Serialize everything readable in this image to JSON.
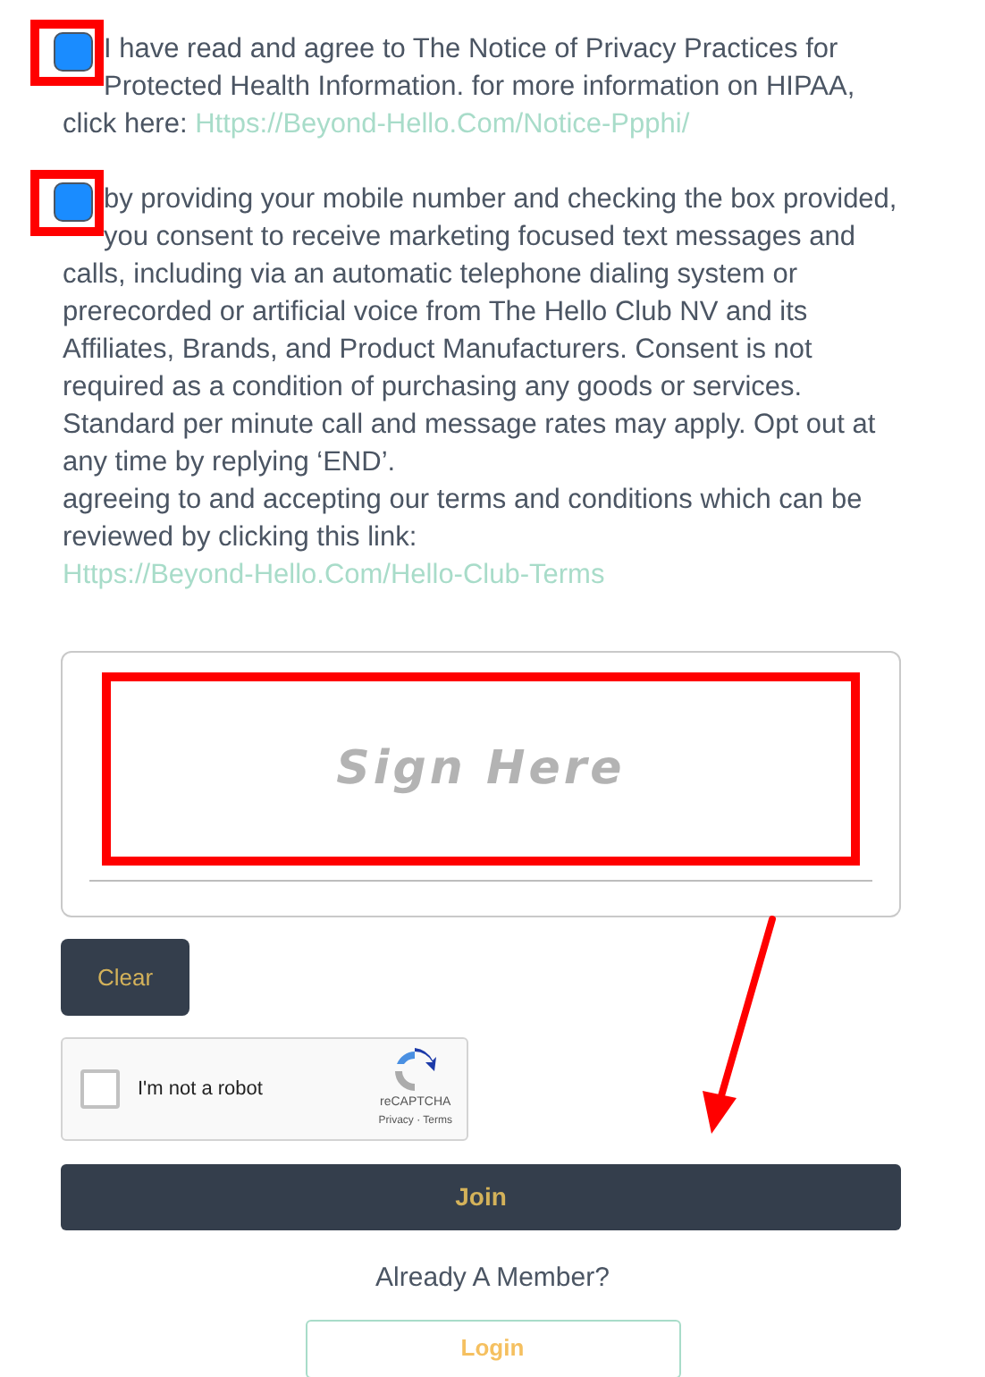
{
  "consents": [
    {
      "checked": true,
      "text": "I have read and agree to The Notice of Privacy Practices for Protected Health Information. for more information on HIPAA, click here:",
      "link": "Https://Beyond-Hello.Com/Notice-Ppphi/"
    },
    {
      "checked": true,
      "text": "by providing your mobile number and checking the box provided, you consent to receive marketing focused text messages and calls, including via an automatic telephone dialing system or prerecorded or artificial voice from The Hello Club NV and its Affiliates, Brands, and Product Manufacturers. Consent is not required as a condition of purchasing any goods or services. Standard per minute call and message rates may apply. Opt out at any time by replying ‘END’.",
      "text_2": "agreeing to and accepting our terms and conditions which can be reviewed by clicking this link:",
      "link": "Https://Beyond-Hello.Com/Hello-Club-Terms"
    }
  ],
  "signature": {
    "placeholder": "Sign Here"
  },
  "clear_button": "Clear",
  "captcha": {
    "label": "I'm not a robot",
    "checked": false,
    "brand": "reCAPTCHA",
    "links": "Privacy · Terms"
  },
  "join_button": "Join",
  "member_prompt": "Already A Member?",
  "login_button": "Login"
}
